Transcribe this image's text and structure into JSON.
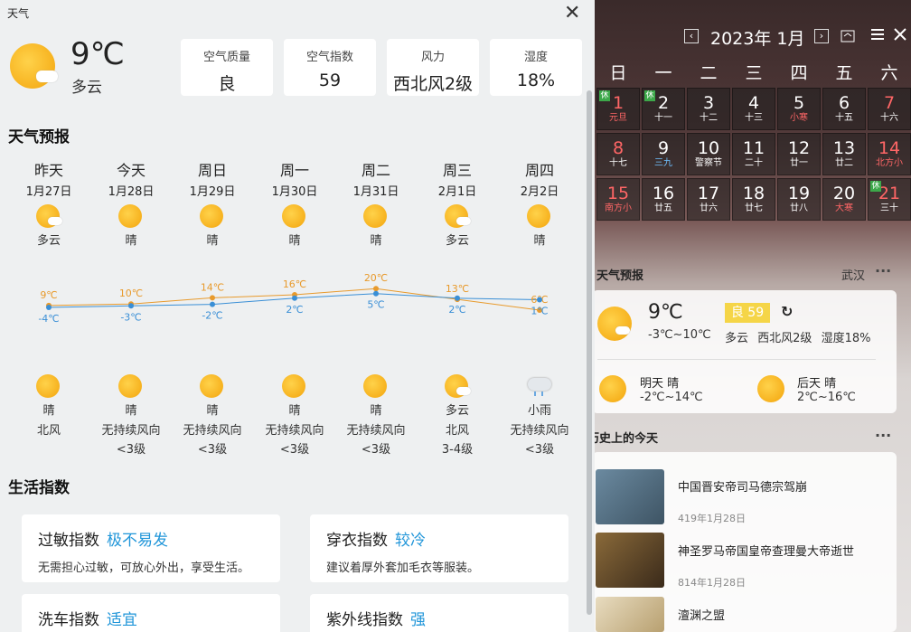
{
  "window": {
    "title": "天气",
    "close_label": "✕"
  },
  "current": {
    "temp": "9℃",
    "condition": "多云"
  },
  "stats": [
    {
      "label": "空气质量",
      "value": "良"
    },
    {
      "label": "空气指数",
      "value": "59"
    },
    {
      "label": "风力",
      "value": "西北风2级"
    },
    {
      "label": "湿度",
      "value": "18%"
    }
  ],
  "forecast_title": "天气预报",
  "days": [
    {
      "name": "昨天",
      "date": "1月27日",
      "day_cond": "多云",
      "high": "9℃",
      "low": "-4℃",
      "night_cond": "晴",
      "wind": "北风",
      "wind_level": "",
      "day_icon": "partly-cloudy-icon",
      "night_icon": "sun-icon"
    },
    {
      "name": "今天",
      "date": "1月28日",
      "day_cond": "晴",
      "high": "10℃",
      "low": "-3℃",
      "night_cond": "晴",
      "wind": "无持续风向",
      "wind_level": "<3级",
      "day_icon": "sun-icon",
      "night_icon": "sun-icon"
    },
    {
      "name": "周日",
      "date": "1月29日",
      "day_cond": "晴",
      "high": "14℃",
      "low": "-2℃",
      "night_cond": "晴",
      "wind": "无持续风向",
      "wind_level": "<3级",
      "day_icon": "sun-icon",
      "night_icon": "sun-icon"
    },
    {
      "name": "周一",
      "date": "1月30日",
      "day_cond": "晴",
      "high": "16℃",
      "low": "2℃",
      "night_cond": "晴",
      "wind": "无持续风向",
      "wind_level": "<3级",
      "day_icon": "sun-icon",
      "night_icon": "sun-icon"
    },
    {
      "name": "周二",
      "date": "1月31日",
      "day_cond": "晴",
      "high": "20℃",
      "low": "5℃",
      "night_cond": "晴",
      "wind": "无持续风向",
      "wind_level": "<3级",
      "day_icon": "sun-icon",
      "night_icon": "sun-icon"
    },
    {
      "name": "周三",
      "date": "2月1日",
      "day_cond": "多云",
      "high": "13℃",
      "low": "2℃",
      "night_cond": "多云",
      "wind": "北风",
      "wind_level": "3-4级",
      "day_icon": "partly-cloudy-icon",
      "night_icon": "partly-cloudy-icon"
    },
    {
      "name": "周四",
      "date": "2月2日",
      "day_cond": "晴",
      "high": "6℃",
      "low": "1℃",
      "night_cond": "小雨",
      "wind": "无持续风向",
      "wind_level": "<3级",
      "day_icon": "sun-icon",
      "night_icon": "light-rain-icon"
    }
  ],
  "temps_high": [
    9,
    10,
    14,
    16,
    20,
    13,
    6
  ],
  "temps_low": [
    -4,
    -3,
    -2,
    2,
    5,
    2,
    1
  ],
  "colors": {
    "high_line": "#e89a2c",
    "low_line": "#3a8fd6",
    "accent": "#2196d9"
  },
  "life_title": "生活指数",
  "life": [
    {
      "name": "过敏指数",
      "value": "极不易发",
      "desc": "无需担心过敏，可放心外出，享受生活。"
    },
    {
      "name": "穿衣指数",
      "value": "较冷",
      "desc": "建议着厚外套加毛衣等服装。"
    },
    {
      "name": "洗车指数",
      "value": "适宜",
      "desc": ""
    },
    {
      "name": "紫外线指数",
      "value": "强",
      "desc": ""
    }
  ],
  "calendar": {
    "title": "2023年 1月",
    "prev": "‹",
    "next": "›",
    "weekdays": [
      "日",
      "一",
      "二",
      "三",
      "四",
      "五",
      "六"
    ],
    "rows": [
      [
        {
          "d": "1",
          "l": "元旦",
          "red": true,
          "lred": true,
          "rest": true
        },
        {
          "d": "2",
          "l": "十一",
          "rest": true
        },
        {
          "d": "3",
          "l": "十二"
        },
        {
          "d": "4",
          "l": "十三"
        },
        {
          "d": "5",
          "l": "小寒",
          "lred": true
        },
        {
          "d": "6",
          "l": "十五"
        },
        {
          "d": "7",
          "l": "十六",
          "red": true
        }
      ],
      [
        {
          "d": "8",
          "l": "十七",
          "red": true
        },
        {
          "d": "9",
          "l": "三九",
          "lblue": true
        },
        {
          "d": "10",
          "l": "警察节"
        },
        {
          "d": "11",
          "l": "二十"
        },
        {
          "d": "12",
          "l": "廿一"
        },
        {
          "d": "13",
          "l": "廿二"
        },
        {
          "d": "14",
          "l": "北方小",
          "red": true,
          "lred": true
        }
      ],
      [
        {
          "d": "15",
          "l": "南方小",
          "red": true,
          "lred": true
        },
        {
          "d": "16",
          "l": "廿五"
        },
        {
          "d": "17",
          "l": "廿六"
        },
        {
          "d": "18",
          "l": "廿七"
        },
        {
          "d": "19",
          "l": "廿八"
        },
        {
          "d": "20",
          "l": "大寒",
          "lred": true
        },
        {
          "d": "21",
          "l": "三十",
          "red": true,
          "rest": true
        }
      ]
    ],
    "rest_label": "休"
  },
  "rp_weather": {
    "title": "天气预报",
    "city": "武汉",
    "temp": "9℃",
    "range": "-3℃~10℃",
    "aq": "良 59",
    "cond": "多云",
    "wind": "西北风2级",
    "humidity": "湿度18%",
    "tomorrow_label": "明天 晴",
    "tomorrow_range": "-2℃~14℃",
    "after_label": "后天 晴",
    "after_range": "2℃~16℃",
    "refresh": "↻",
    "more": "···"
  },
  "history": {
    "title": "历史上的今天",
    "more": "···",
    "items": [
      {
        "title": "中国晋安帝司马德宗驾崩",
        "date": "419年1月28日"
      },
      {
        "title": "神圣罗马帝国皇帝查理曼大帝逝世",
        "date": "814年1月28日"
      },
      {
        "title": "澶渊之盟",
        "date": ""
      }
    ]
  }
}
